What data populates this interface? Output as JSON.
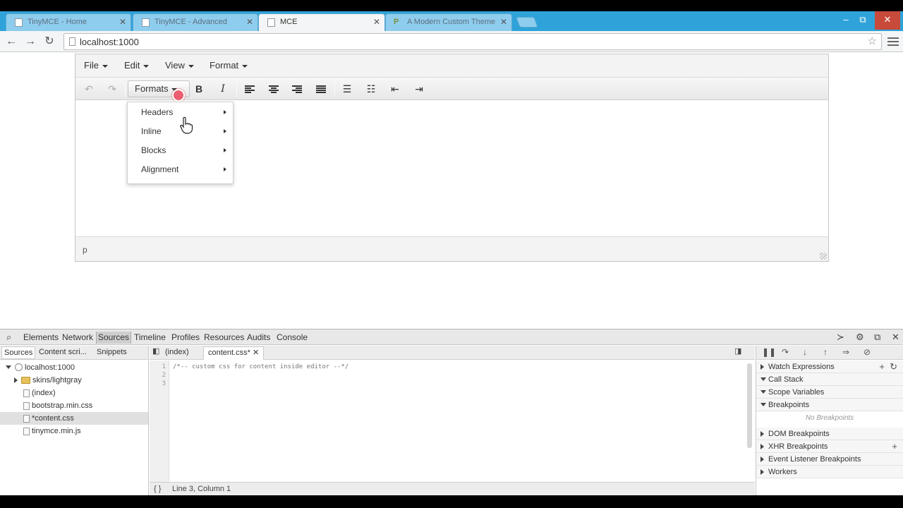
{
  "browser": {
    "tabs": [
      {
        "title": "TinyMCE - Home"
      },
      {
        "title": "TinyMCE - Advanced"
      },
      {
        "title": "MCE"
      },
      {
        "title": "A Modern Custom Theme"
      }
    ],
    "url": "localhost:1000",
    "window_controls": {
      "minimize": "–",
      "maximize": "⧉",
      "close": "✕"
    }
  },
  "editor": {
    "menubar": [
      {
        "label": "File"
      },
      {
        "label": "Edit"
      },
      {
        "label": "View"
      },
      {
        "label": "Format"
      }
    ],
    "formats_label": "Formats",
    "bold_label": "B",
    "italic_label": "I",
    "status_path": "p",
    "formats_menu": [
      {
        "label": "Headers"
      },
      {
        "label": "Inline"
      },
      {
        "label": "Blocks"
      },
      {
        "label": "Alignment"
      }
    ]
  },
  "devtools": {
    "tabs": [
      {
        "label": "Elements"
      },
      {
        "label": "Network"
      },
      {
        "label": "Sources"
      },
      {
        "label": "Timeline"
      },
      {
        "label": "Profiles"
      },
      {
        "label": "Resources"
      },
      {
        "label": "Audits"
      },
      {
        "label": "Console"
      }
    ],
    "nav_tabs": [
      {
        "label": "Sources"
      },
      {
        "label": "Content scri..."
      },
      {
        "label": "Snippets"
      }
    ],
    "tree": [
      {
        "label": "localhost:1000"
      },
      {
        "label": "skins/lightgray"
      },
      {
        "label": "(index)"
      },
      {
        "label": "bootstrap.min.css"
      },
      {
        "label": "*content.css"
      },
      {
        "label": "tinymce.min.js"
      }
    ],
    "editor_tabs": [
      {
        "label": "(index)"
      },
      {
        "label": "content.css*"
      }
    ],
    "code_lines": [
      {
        "num": "1",
        "text": "/*-- custom css for content inside editor --*/"
      },
      {
        "num": "2",
        "text": ""
      },
      {
        "num": "3",
        "text": ""
      }
    ],
    "cursor_status": "Line 3, Column 1",
    "format_icon": "{ }",
    "panes": [
      {
        "label": "Watch Expressions"
      },
      {
        "label": "Call Stack"
      },
      {
        "label": "Scope Variables"
      },
      {
        "label": "Breakpoints"
      },
      {
        "label": "DOM Breakpoints"
      },
      {
        "label": "XHR Breakpoints"
      },
      {
        "label": "Event Listener Breakpoints"
      },
      {
        "label": "Workers"
      }
    ],
    "no_breakpoints": "No Breakpoints"
  },
  "colors": {
    "tabstrip": "#2fa3d9",
    "click_indicator": "#eb465a"
  }
}
